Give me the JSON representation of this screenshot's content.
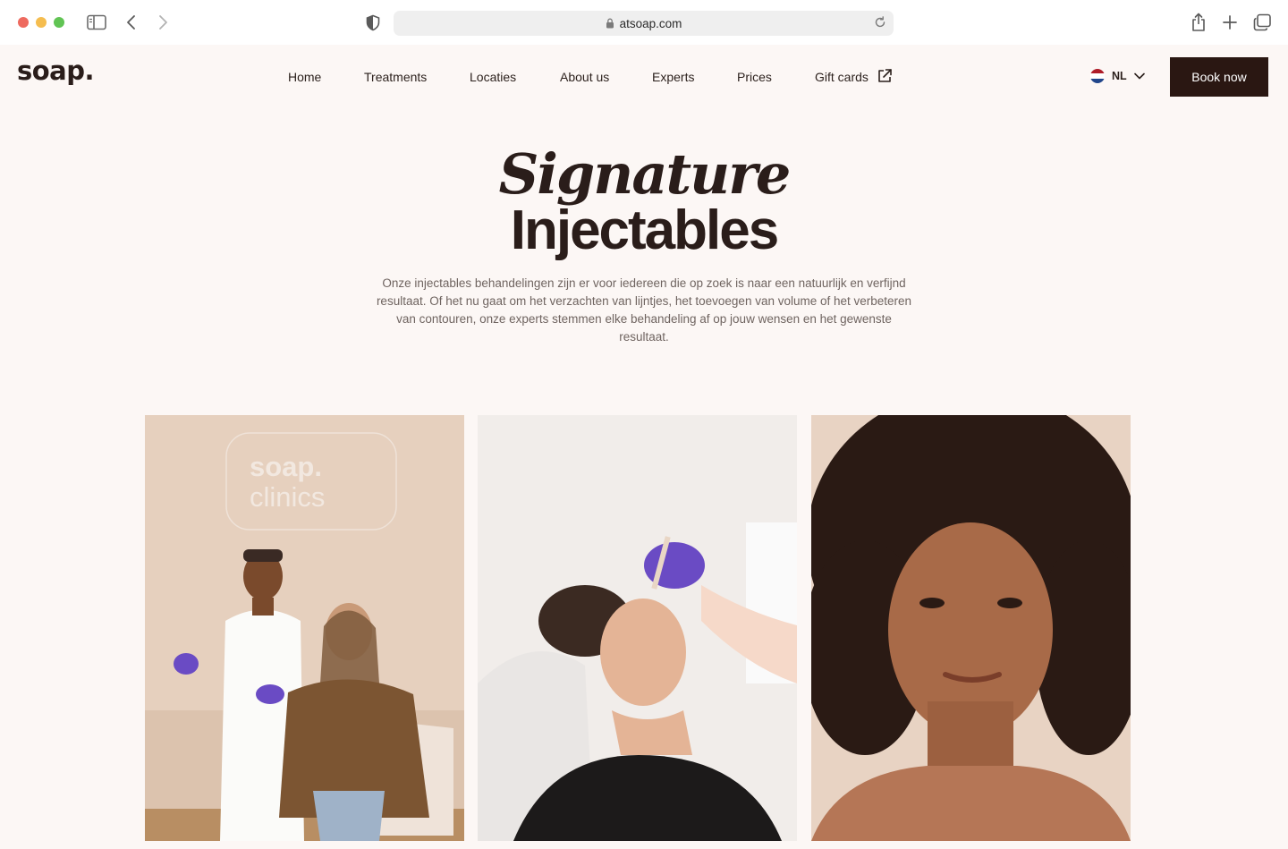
{
  "browser": {
    "url": "atsoap.com"
  },
  "site": {
    "logo": "soap.",
    "nav": [
      {
        "label": "Home"
      },
      {
        "label": "Treatments"
      },
      {
        "label": "Locaties"
      },
      {
        "label": "About us"
      },
      {
        "label": "Experts"
      },
      {
        "label": "Prices"
      },
      {
        "label": "Gift cards"
      }
    ],
    "language": "NL",
    "book_label": "Book now"
  },
  "hero": {
    "title_script": "Signature",
    "title_main": "Injectables",
    "intro_lines": [
      "Onze injectables behandelingen zijn er voor iedereen die op zoek is naar een natuurlijk en verfijnd",
      "resultaat. Of het nu gaat om het verzachten van lijntjes, het toevoegen van volume of het verbeteren",
      "van contouren, onze experts stemmen elke behandeling af op jouw wensen en het gewenste",
      "resultaat."
    ]
  },
  "gallery": {
    "photo1_sign": [
      "soap.",
      "clinics"
    ]
  },
  "colors": {
    "page_bg": "#fcf7f5",
    "button_bg": "#2a1712",
    "text": "#2a1f1b",
    "glove": "#6a4bc4"
  }
}
